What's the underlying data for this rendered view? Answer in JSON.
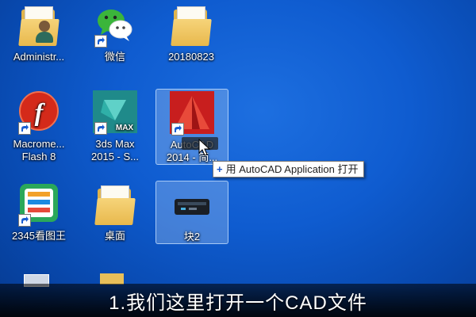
{
  "desktop": {
    "icons": [
      {
        "label": "Administr...",
        "icon": "user-folder-icon"
      },
      {
        "label": "微信",
        "icon": "wechat-icon"
      },
      {
        "label": "20180823",
        "icon": "folder-icon"
      },
      {
        "label": "Macrome...\nFlash 8",
        "icon": "flash-icon"
      },
      {
        "label": "3ds Max\n2015 - S...",
        "icon": "3ds-max-icon"
      },
      {
        "label": "AutoCAD\n2014 - 简...",
        "icon": "autocad-icon"
      },
      {
        "label": "2345看图王",
        "icon": "image-viewer-icon"
      },
      {
        "label": "桌面",
        "icon": "folder-icon"
      },
      {
        "label": "块2",
        "icon": "dwg-file-icon"
      }
    ]
  },
  "tooltip": {
    "text": "用 AutoCAD Application 打开",
    "icon": "plus-icon"
  },
  "subtitle": {
    "text": "1.我们这里打开一个CAD文件"
  },
  "colors": {
    "desktop": "#0f5cd0",
    "flash": "#d42a1a",
    "autocad": "#c81e1e",
    "max": "#1f8a8a",
    "wechat": "#3bb53b"
  }
}
